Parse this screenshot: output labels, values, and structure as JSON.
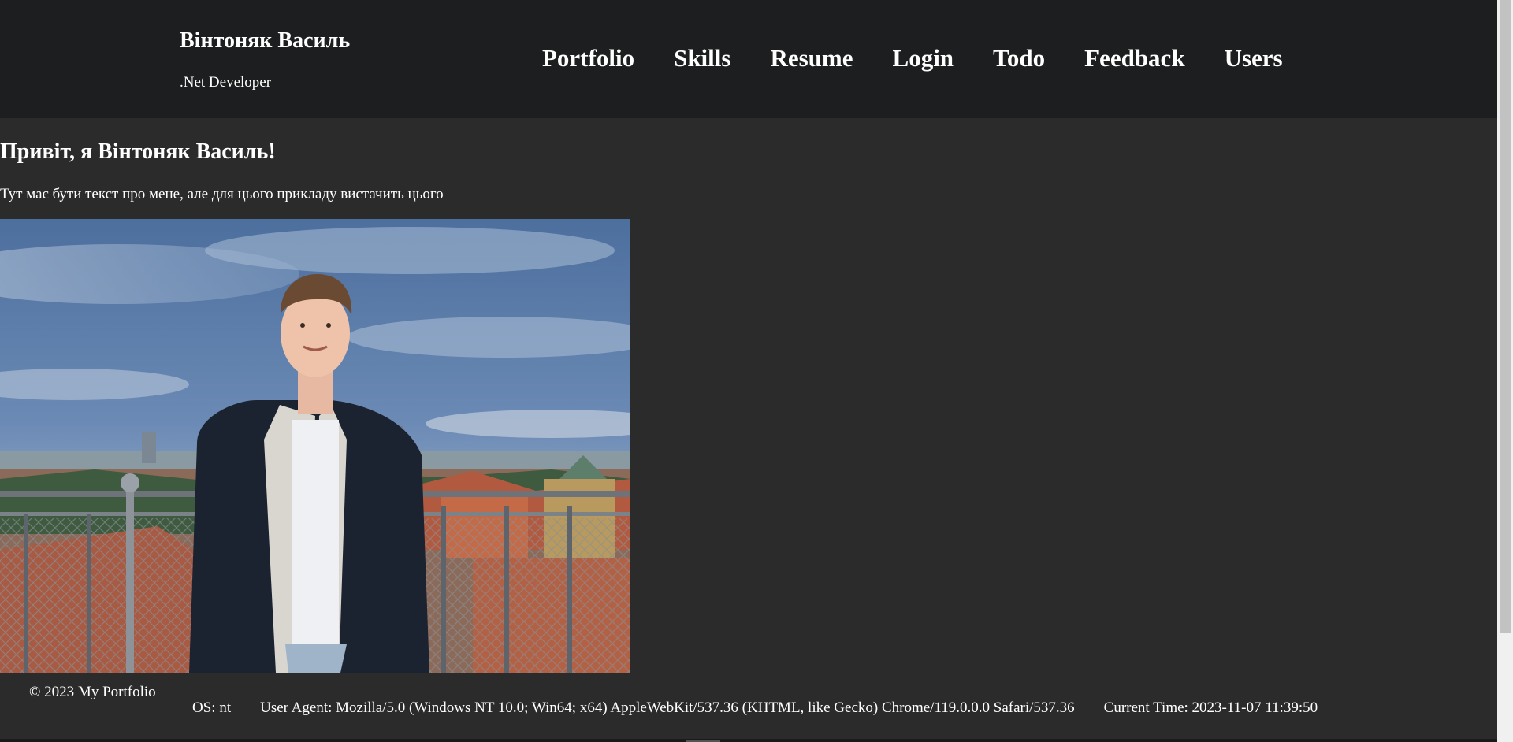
{
  "header": {
    "name": "Вінтоняк Василь",
    "role": ".Net Developer",
    "nav": [
      {
        "label": "Portfolio"
      },
      {
        "label": "Skills"
      },
      {
        "label": "Resume"
      },
      {
        "label": "Login"
      },
      {
        "label": "Todo"
      },
      {
        "label": "Feedback"
      },
      {
        "label": "Users"
      }
    ]
  },
  "main": {
    "heading": "Привіт, я Вінтоняк Василь!",
    "intro": "Тут має бути текст про мене, але для цього прикладу вистачить цього"
  },
  "footer": {
    "copyright": "© 2023 My Portfolio",
    "os": "OS: nt",
    "user_agent": "User Agent: Mozilla/5.0 (Windows NT 10.0; Win64; x64) AppleWebKit/537.36 (KHTML, like Gecko) Chrome/119.0.0.0 Safari/537.36",
    "current_time": "Current Time: 2023-11-07 11:39:50"
  },
  "colors": {
    "header_bg": "#1d1e1f",
    "page_bg": "#2b2b2b",
    "text": "#ffffff"
  }
}
